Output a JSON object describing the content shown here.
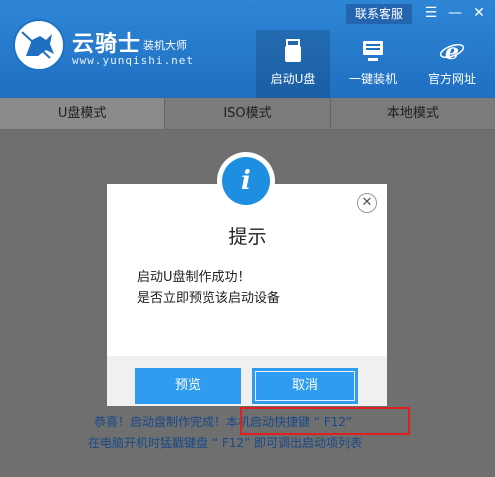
{
  "header": {
    "brand_name": "云骑士",
    "brand_sub": "装机大师",
    "brand_url": "www.yunqishi.net",
    "contact_label": "联系客服",
    "minimize_symbol": "☰",
    "maximize_symbol": "—",
    "close_symbol": "✕",
    "nav": [
      {
        "label": "启动U盘",
        "icon": "usb-drive-icon"
      },
      {
        "label": "一键装机",
        "icon": "computer-install-icon"
      },
      {
        "label": "官方网址",
        "icon": "ie-browser-icon"
      }
    ]
  },
  "tabs": [
    {
      "label": "U盘模式"
    },
    {
      "label": "ISO模式"
    },
    {
      "label": "本地模式"
    }
  ],
  "dialog": {
    "icon_symbol": "i",
    "title": "提示",
    "line1": "启动U盘制作成功！",
    "line2": "是否立即预览该启动设备",
    "close_symbol": "✕",
    "preview_label": "预览",
    "cancel_label": "取消"
  },
  "messages": {
    "line1": "恭喜！启动盘制作完成！本机启动快捷键 “ F12”",
    "line2": "在电脑开机时猛戳键盘 “ F12” 即可调出启动项列表"
  },
  "colors": {
    "header_blue": "#2178c9",
    "primary_button": "#2f9cf1",
    "highlight_red": "#e02020",
    "info_blue": "#1e8fe0"
  }
}
